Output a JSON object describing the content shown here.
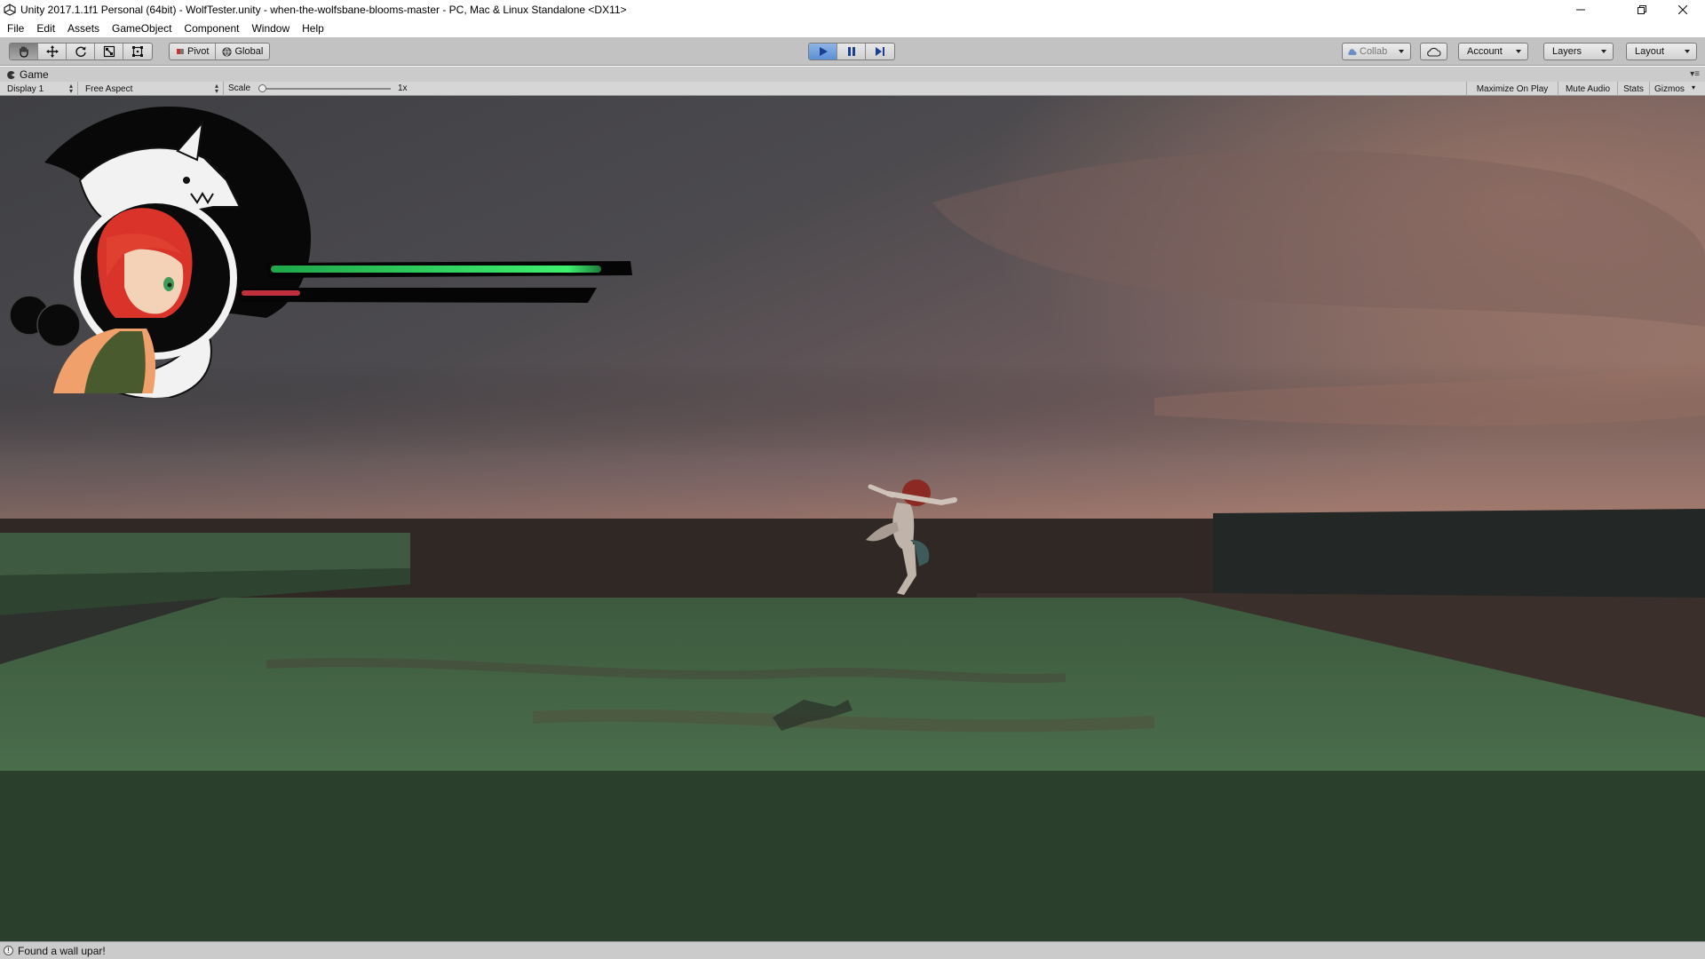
{
  "window": {
    "title": "Unity 2017.1.1f1 Personal (64bit) - WolfTester.unity - when-the-wolfsbane-blooms-master - PC, Mac & Linux Standalone <DX11>"
  },
  "menu": {
    "items": [
      "File",
      "Edit",
      "Assets",
      "GameObject",
      "Component",
      "Window",
      "Help"
    ]
  },
  "toolbar": {
    "pivot_label": "Pivot",
    "global_label": "Global",
    "collab_label": "Collab",
    "account_label": "Account",
    "layers_label": "Layers",
    "layout_label": "Layout",
    "tools": [
      "hand-tool",
      "move-tool",
      "rotate-tool",
      "scale-tool",
      "rect-tool"
    ],
    "play_state": "playing"
  },
  "game_view": {
    "tab_label": "Game",
    "display_label": "Display 1",
    "aspect_label": "Free Aspect",
    "scale_label": "Scale",
    "scale_value": "1x",
    "maximize_on_play": "Maximize On Play",
    "mute_audio": "Mute Audio",
    "stats": "Stats",
    "gizmos": "Gizmos"
  },
  "hud": {
    "health_fraction": 0.93,
    "rage_fraction": 0.17,
    "health_color": "#2fd25a",
    "rage_color": "#c0303a"
  },
  "status": {
    "message": "Found a wall upar!"
  },
  "colors": {
    "editor_bg": "#c2c2c2",
    "play_accent": "#5b8fd6",
    "ground_green": "#3f5c40"
  }
}
